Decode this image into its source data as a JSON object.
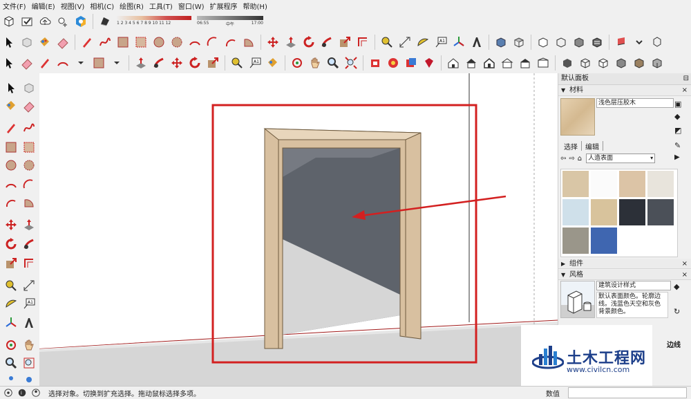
{
  "menu": [
    "文件(F)",
    "编辑(E)",
    "视图(V)",
    "相机(C)",
    "绘图(R)",
    "工具(T)",
    "窗口(W)",
    "扩展程序",
    "帮助(H)"
  ],
  "shadow": {
    "month_ticks": "1 2 3 4 5 6 7 8 9 10 11 12",
    "time_start": "06:55",
    "time_mid": "中午",
    "time_end": "17:00"
  },
  "panel": {
    "title": "默认面板",
    "materials_label": "材料",
    "material_name": "浅色层压胶木",
    "tab_select": "选择",
    "tab_edit": "编辑",
    "library": "人造表面",
    "components_label": "组件",
    "styles_label": "风格",
    "style_name": "建筑设计样式",
    "style_desc": "默认表面颜色。轮廓边线。浅蓝色天空和灰色背景颜色。",
    "edge_label": "边线"
  },
  "swatch_colors": [
    "#d9c6a6",
    "#fbfbfb",
    "#dcc4a6",
    "#e8e4dc",
    "#cfe0ea",
    "#d8c39c",
    "#2c3038",
    "#4b5058",
    "#9a968a",
    "#3f66b0"
  ],
  "colors": {
    "frame_wood": "#d8c0a0",
    "opening": "#5e636b",
    "ground": "#d6d6d6",
    "highlight": "#d32020"
  },
  "status": {
    "hint": "选择对象。切换到扩充选择。拖动鼠标选择多项。",
    "value_label": "数值"
  },
  "watermark": {
    "title": "土木工程网",
    "url": "www.civilcn.com"
  }
}
